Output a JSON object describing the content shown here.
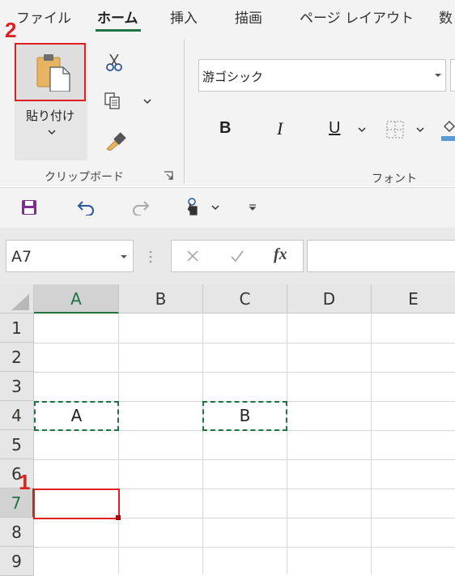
{
  "ribbon": {
    "tabs": [
      "ファイル",
      "ホーム",
      "挿入",
      "描画",
      "ページ レイアウト",
      "数"
    ],
    "active_tab": "ホーム",
    "clipboard": {
      "paste_label": "貼り付け",
      "group_label": "クリップボード"
    },
    "font": {
      "font_name": "游ゴシック",
      "group_label": "フォント",
      "bold": "B",
      "italic": "I",
      "underline": "U"
    }
  },
  "formula_bar": {
    "name_box": "A7",
    "fx": "fx"
  },
  "sheet": {
    "columns": [
      "A",
      "B",
      "C",
      "D",
      "E"
    ],
    "rows": [
      "1",
      "2",
      "3",
      "4",
      "5",
      "6",
      "7",
      "8",
      "9"
    ],
    "cells": {
      "A4": "A",
      "C4": "B"
    },
    "selected_cell": "A7"
  },
  "annotations": {
    "step1": "1",
    "step2": "2"
  },
  "colors": {
    "accent_green": "#217346",
    "highlight_red": "#e02020"
  }
}
